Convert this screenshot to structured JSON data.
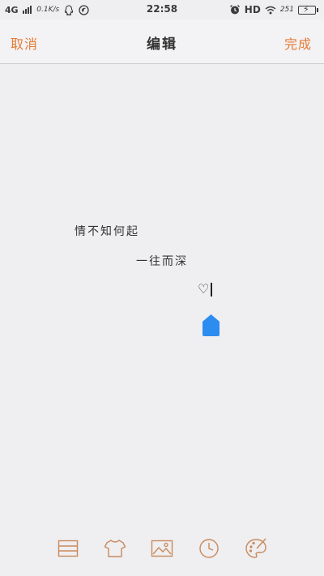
{
  "status_bar": {
    "network": "4G",
    "speed": "0.1K/s",
    "time": "22:58",
    "hd": "HD",
    "battery_level": "251"
  },
  "nav": {
    "cancel_label": "取消",
    "title": "编辑",
    "done_label": "完成"
  },
  "editor": {
    "lines": [
      "情不知何起",
      "一往而深",
      "♡"
    ]
  },
  "toolbar": {
    "icons": [
      "list-icon",
      "shirt-icon",
      "image-icon",
      "clock-icon",
      "palette-icon"
    ]
  },
  "colors": {
    "accent": "#e57b35",
    "background": "#efeef0",
    "cursor_handle": "#2d8cf0"
  }
}
